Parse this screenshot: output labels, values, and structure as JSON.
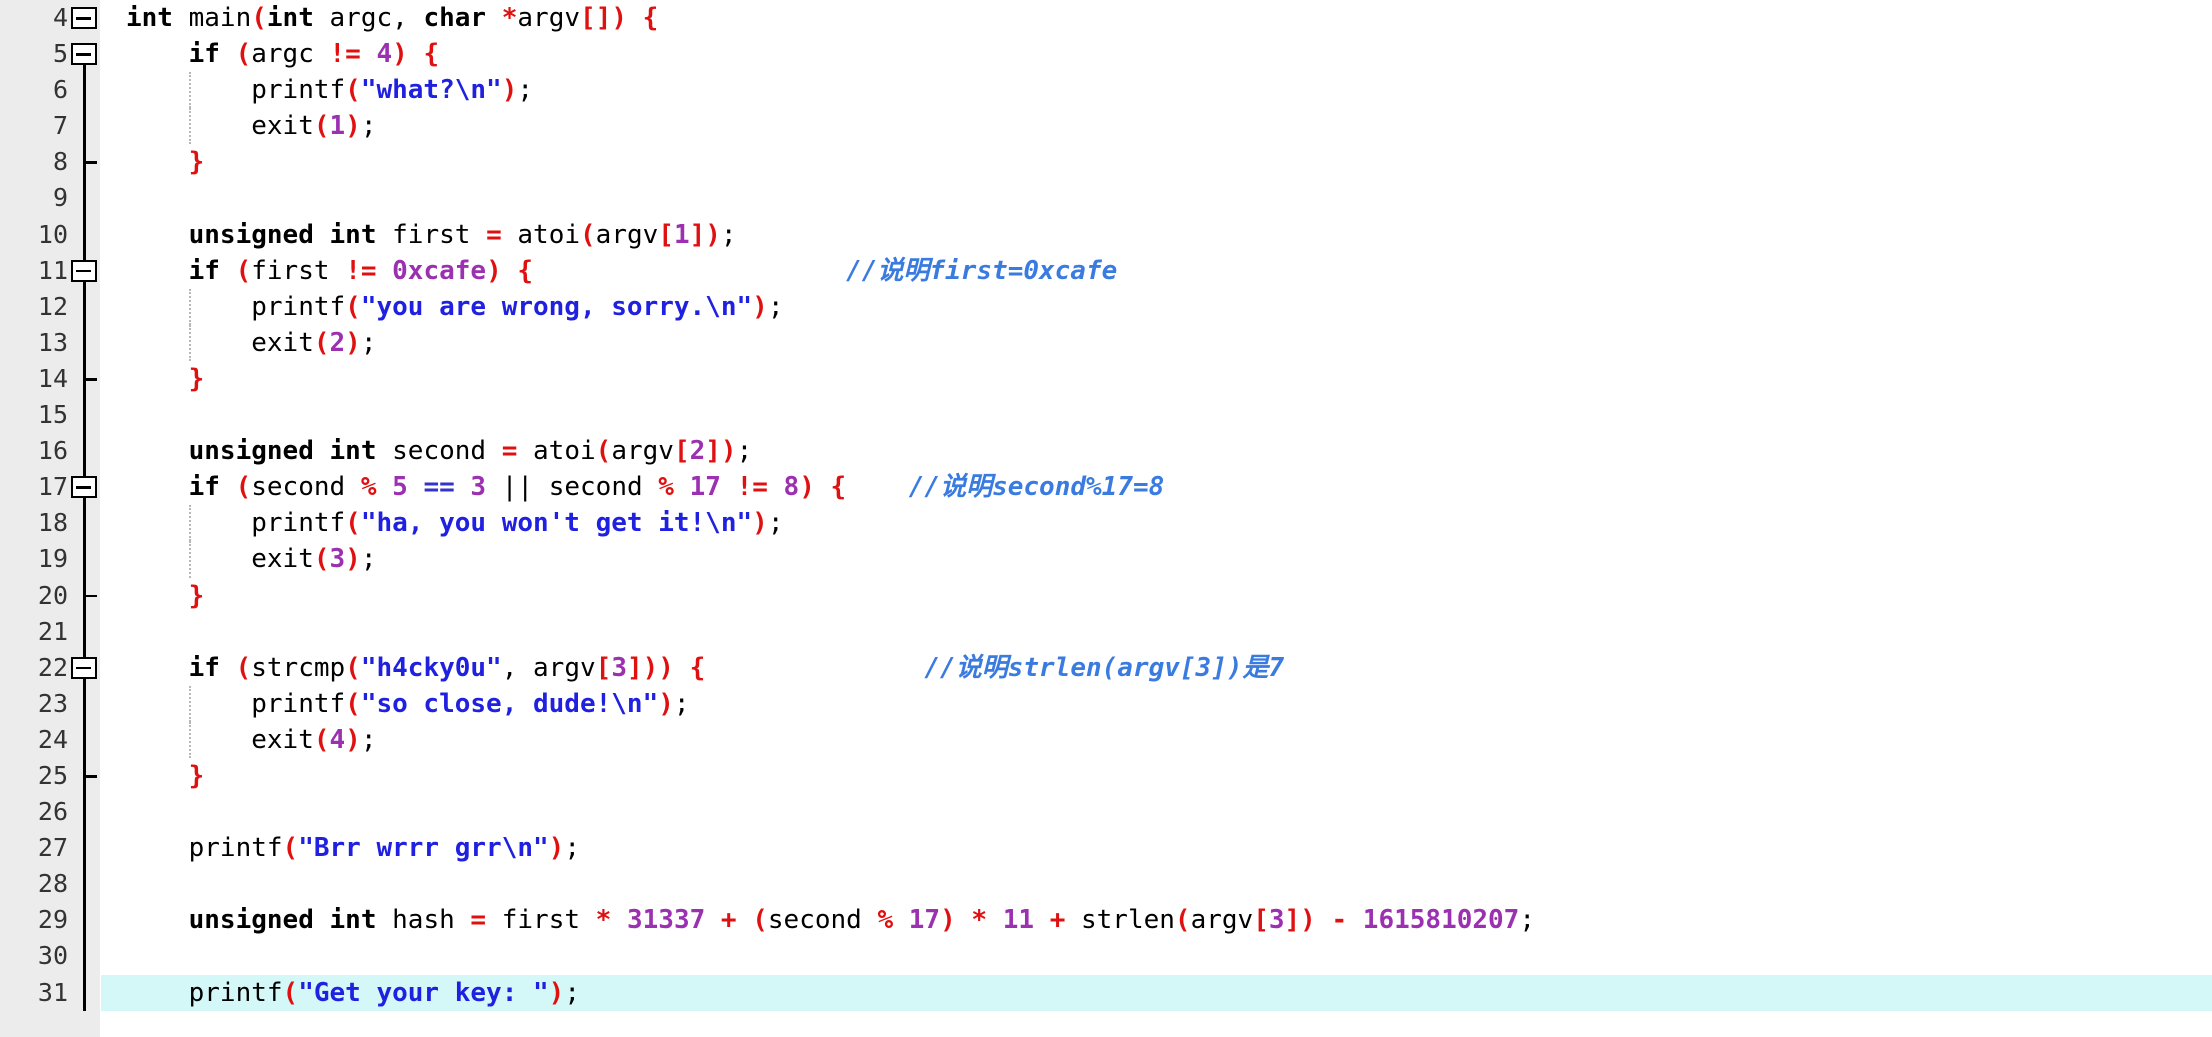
{
  "editor": {
    "name": "c-source-code-editor",
    "language": "C",
    "first_line_number": 4,
    "last_line_number": 31,
    "highlighted_line": 31,
    "gutter_background": "#ececec",
    "highlight_background": "#d4f7f7",
    "colors": {
      "keyword": "#000000",
      "string": "#2020e0",
      "number": "#9b30b0",
      "operator": "#e01010",
      "bracket": "#e01010",
      "logical": "#3333cc",
      "comment": "#3a7be0",
      "identifier": "#000000",
      "line_number": "#333333"
    }
  },
  "line_numbers": [
    4,
    5,
    6,
    7,
    8,
    9,
    10,
    11,
    12,
    13,
    14,
    15,
    16,
    17,
    18,
    19,
    20,
    21,
    22,
    23,
    24,
    25,
    26,
    27,
    28,
    29,
    30,
    31
  ],
  "fold_markers": [
    {
      "line": 4,
      "type": "box"
    },
    {
      "line": 5,
      "type": "box"
    },
    {
      "line": 8,
      "type": "tick"
    },
    {
      "line": 11,
      "type": "box"
    },
    {
      "line": 14,
      "type": "tick"
    },
    {
      "line": 17,
      "type": "box"
    },
    {
      "line": 20,
      "type": "tick"
    },
    {
      "line": 22,
      "type": "box"
    },
    {
      "line": 25,
      "type": "tick"
    }
  ],
  "code_lines": [
    {
      "n": 4,
      "text": "int main(int argc, char *argv[]) {",
      "indent_guides": 0
    },
    {
      "n": 5,
      "text": "    if (argc != 4) {",
      "indent_guides": 0
    },
    {
      "n": 6,
      "text": "        printf(\"what?\\n\");",
      "indent_guides": 1
    },
    {
      "n": 7,
      "text": "        exit(1);",
      "indent_guides": 1
    },
    {
      "n": 8,
      "text": "    }",
      "indent_guides": 0
    },
    {
      "n": 9,
      "text": "",
      "indent_guides": 0
    },
    {
      "n": 10,
      "text": "    unsigned int first = atoi(argv[1]);",
      "indent_guides": 0
    },
    {
      "n": 11,
      "text": "    if (first != 0xcafe) {                    //说明first=0xcafe",
      "indent_guides": 0
    },
    {
      "n": 12,
      "text": "        printf(\"you are wrong, sorry.\\n\");",
      "indent_guides": 1
    },
    {
      "n": 13,
      "text": "        exit(2);",
      "indent_guides": 1
    },
    {
      "n": 14,
      "text": "    }",
      "indent_guides": 0
    },
    {
      "n": 15,
      "text": "",
      "indent_guides": 0
    },
    {
      "n": 16,
      "text": "    unsigned int second = atoi(argv[2]);",
      "indent_guides": 0
    },
    {
      "n": 17,
      "text": "    if (second % 5 == 3 || second % 17 != 8) {    //说明second%17=8",
      "indent_guides": 0
    },
    {
      "n": 18,
      "text": "        printf(\"ha, you won't get it!\\n\");",
      "indent_guides": 1
    },
    {
      "n": 19,
      "text": "        exit(3);",
      "indent_guides": 1
    },
    {
      "n": 20,
      "text": "    }",
      "indent_guides": 0
    },
    {
      "n": 21,
      "text": "",
      "indent_guides": 0
    },
    {
      "n": 22,
      "text": "    if (strcmp(\"h4cky0u\", argv[3])) {              //说明strlen(argv[3])是7",
      "indent_guides": 0
    },
    {
      "n": 23,
      "text": "        printf(\"so close, dude!\\n\");",
      "indent_guides": 1
    },
    {
      "n": 24,
      "text": "        exit(4);",
      "indent_guides": 1
    },
    {
      "n": 25,
      "text": "    }",
      "indent_guides": 0
    },
    {
      "n": 26,
      "text": "",
      "indent_guides": 0
    },
    {
      "n": 27,
      "text": "    printf(\"Brr wrrr grr\\n\");",
      "indent_guides": 0
    },
    {
      "n": 28,
      "text": "",
      "indent_guides": 0
    },
    {
      "n": 29,
      "text": "    unsigned int hash = first * 31337 + (second % 17) * 11 + strlen(argv[3]) - 1615810207;",
      "indent_guides": 0
    },
    {
      "n": 30,
      "text": "",
      "indent_guides": 0
    },
    {
      "n": 31,
      "text": "    printf(\"Get your key: \");",
      "indent_guides": 0
    }
  ],
  "comments": [
    {
      "line": 11,
      "text": "//说明first=0xcafe"
    },
    {
      "line": 17,
      "text": "//说明second%17=8"
    },
    {
      "line": 22,
      "text": "//说明strlen(argv[3])是7"
    }
  ],
  "strings": [
    {
      "line": 6,
      "value": "\"what?\\n\""
    },
    {
      "line": 12,
      "value": "\"you are wrong, sorry.\\n\""
    },
    {
      "line": 18,
      "value": "\"ha, you won't get it!\\n\""
    },
    {
      "line": 22,
      "value": "\"h4cky0u\""
    },
    {
      "line": 23,
      "value": "\"so close, dude!\\n\""
    },
    {
      "line": 27,
      "value": "\"Brr wrrr grr\\n\""
    },
    {
      "line": 31,
      "value": "\"Get your key: \""
    }
  ],
  "numbers": [
    {
      "line": 5,
      "value": "4"
    },
    {
      "line": 7,
      "value": "1"
    },
    {
      "line": 10,
      "value": "1"
    },
    {
      "line": 11,
      "value": "0xcafe"
    },
    {
      "line": 13,
      "value": "2"
    },
    {
      "line": 16,
      "value": "2"
    },
    {
      "line": 17,
      "values": [
        "5",
        "3",
        "17",
        "8"
      ]
    },
    {
      "line": 19,
      "value": "3"
    },
    {
      "line": 22,
      "value": "3"
    },
    {
      "line": 24,
      "value": "4"
    },
    {
      "line": 29,
      "values": [
        "31337",
        "17",
        "11",
        "3",
        "1615810207"
      ]
    }
  ]
}
